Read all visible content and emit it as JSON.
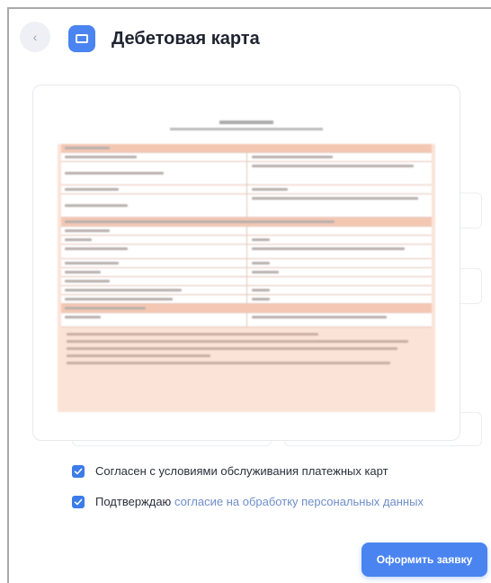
{
  "header": {
    "back_icon": "chevron-left-icon",
    "card_icon": "credit-card-icon",
    "title": "Дебетовая карта"
  },
  "consents": {
    "terms_label": "Согласен с условиями обслуживания платежных карт",
    "personal_prefix": "Подтверждаю",
    "personal_link": "согласие на обработку персональных  данных",
    "terms_checked": true,
    "personal_checked": true
  },
  "actions": {
    "submit_label": "Оформить заявку"
  },
  "colors": {
    "accent": "#4a84f0",
    "checkbox": "#3b7ce8",
    "link": "#6f8fc9",
    "doc_highlight": "#f4c7b3"
  }
}
